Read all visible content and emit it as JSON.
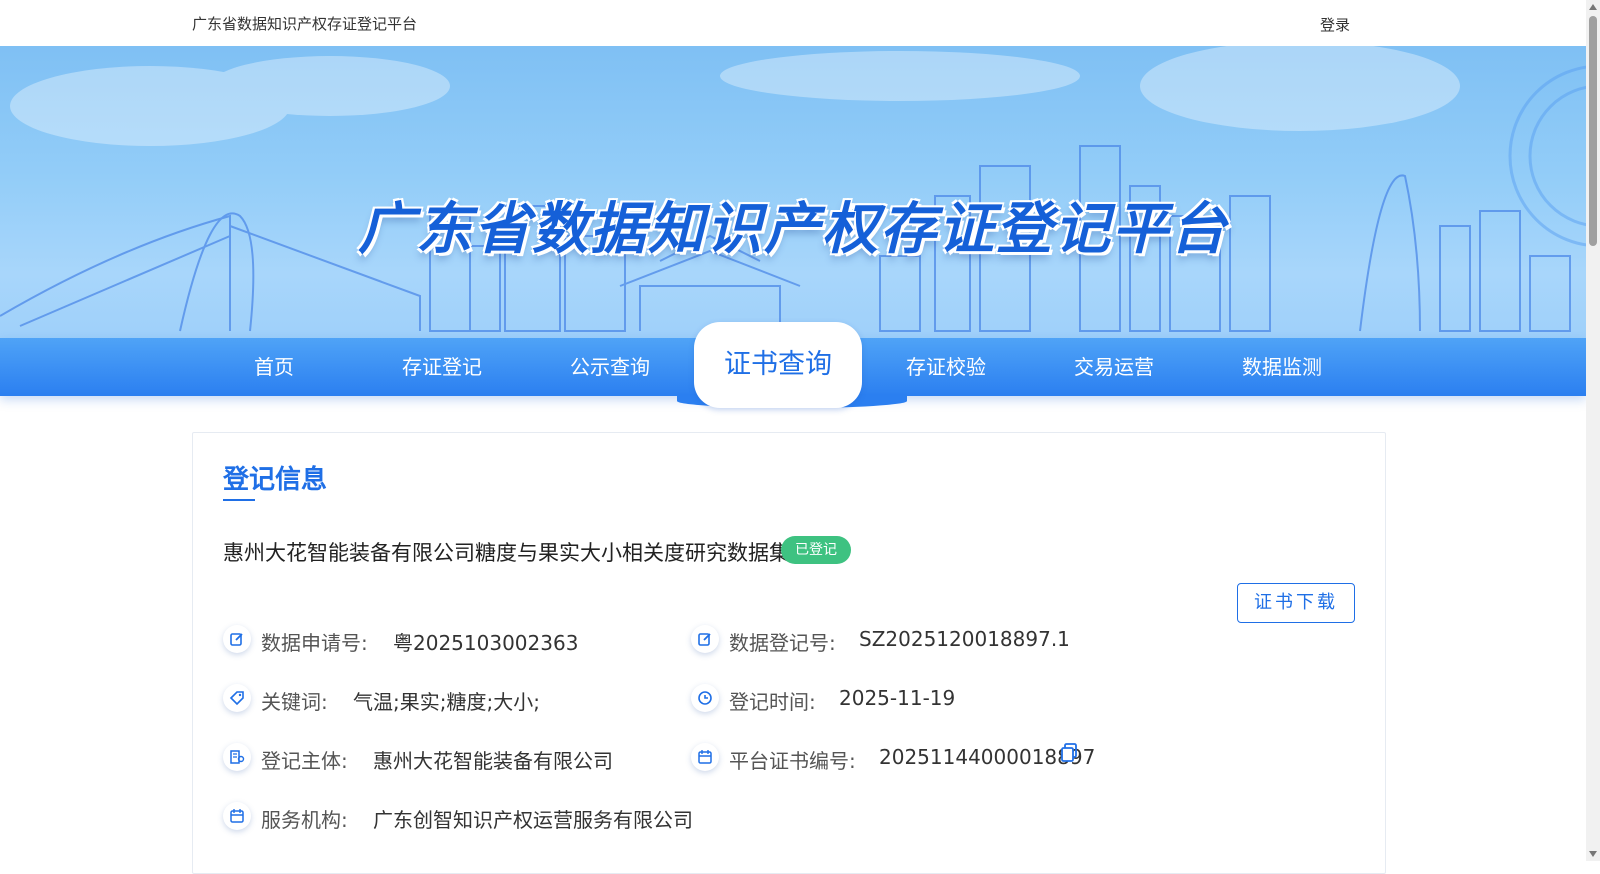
{
  "topbar": {
    "site_title": "广东省数据知识产权存证登记平台",
    "login_label": "登录"
  },
  "banner": {
    "title": "广东省数据知识产权存证登记平台"
  },
  "nav": {
    "items": [
      {
        "label": "首页"
      },
      {
        "label": "存证登记"
      },
      {
        "label": "公示查询"
      },
      {
        "label": "证书查询",
        "active": true
      },
      {
        "label": "存证校验"
      },
      {
        "label": "交易运营"
      },
      {
        "label": "数据监测"
      }
    ]
  },
  "card": {
    "section_title": "登记信息",
    "record_name": "惠州大花智能装备有限公司糖度与果实大小相关度研究数据集",
    "status_badge": "已登记",
    "download_label": "证书下载",
    "fields": {
      "apply_no": {
        "label": "数据申请号:",
        "value": "粤2025103002363",
        "icon": "edit-icon"
      },
      "reg_no": {
        "label": "数据登记号:",
        "value": "SZ2025120018897.1",
        "icon": "edit-icon"
      },
      "keywords": {
        "label": "关键词:",
        "value": "气温;果实;糖度;大小;",
        "icon": "tag-icon"
      },
      "reg_time": {
        "label": "登记时间:",
        "value": "2025-11-19",
        "icon": "clock-icon"
      },
      "subject": {
        "label": "登记主体:",
        "value": "惠州大花智能装备有限公司",
        "icon": "building-user-icon"
      },
      "cert_no": {
        "label": "平台证书编号:",
        "value": "20251144000018897",
        "icon": "calendar-icon"
      },
      "agency": {
        "label": "服务机构:",
        "value": "广东创智知识产权运营服务有限公司",
        "icon": "calendar-icon"
      }
    }
  },
  "colors": {
    "accent": "#1f6fe6",
    "nav_bg": "#2b7ff0",
    "badge_green": "#3ec281"
  }
}
